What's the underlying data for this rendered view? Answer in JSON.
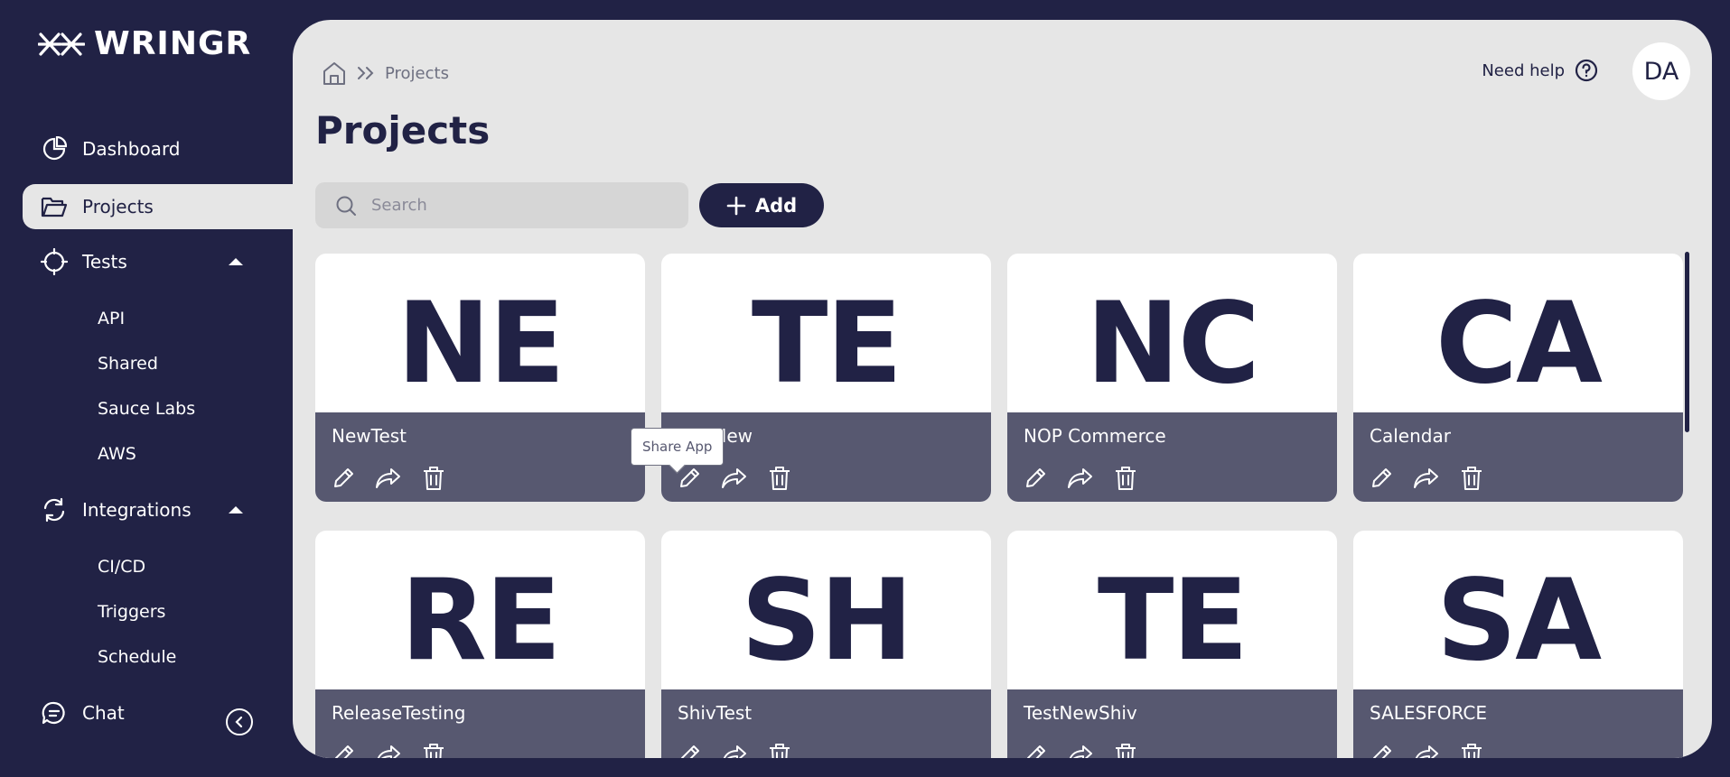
{
  "app": {
    "name": "WRINGR"
  },
  "sidebar": {
    "items": [
      {
        "label": "Dashboard",
        "icon": "pie-chart-icon"
      },
      {
        "label": "Projects",
        "icon": "folder-icon",
        "active": true
      },
      {
        "label": "Tests",
        "icon": "crosshair-icon",
        "expanded": true,
        "children": [
          "API",
          "Shared",
          "Sauce Labs",
          "AWS"
        ]
      },
      {
        "label": "Integrations",
        "icon": "refresh-icon",
        "expanded": true,
        "children": [
          "CI/CD",
          "Triggers",
          "Schedule"
        ]
      },
      {
        "label": "Chat",
        "icon": "chat-icon"
      }
    ],
    "collapse_icon": "chevron-left-icon"
  },
  "header": {
    "breadcrumb": {
      "home_icon": "home-icon",
      "separator_icon": "double-chevron-right-icon",
      "current": "Projects"
    },
    "title": "Projects",
    "help_label": "Need help",
    "help_icon": "question-circle-icon",
    "avatar_initials": "DA"
  },
  "toolbar": {
    "search_placeholder": "Search",
    "add_label": "Add"
  },
  "tooltip": {
    "text": "Share App"
  },
  "projects": [
    {
      "abbr": "NE",
      "name": "NewTest"
    },
    {
      "abbr": "TE",
      "name": "TestNew"
    },
    {
      "abbr": "NC",
      "name": "NOP Commerce"
    },
    {
      "abbr": "CA",
      "name": "Calendar"
    },
    {
      "abbr": "RE",
      "name": "ReleaseTesting"
    },
    {
      "abbr": "SH",
      "name": "ShivTest"
    },
    {
      "abbr": "TE",
      "name": "TestNewShiv"
    },
    {
      "abbr": "SA",
      "name": "SALESFORCE"
    }
  ],
  "colors": {
    "navy": "#212245",
    "panel": "#e6e6e6",
    "card_footer": "#575870"
  }
}
